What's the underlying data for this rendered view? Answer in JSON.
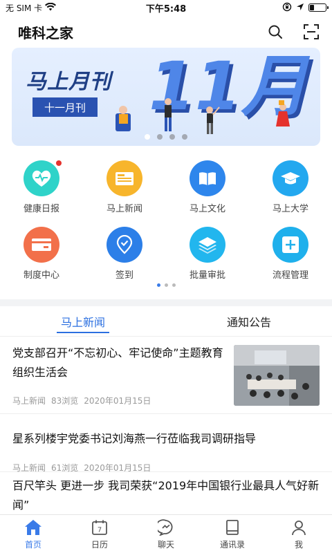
{
  "status_bar": {
    "carrier": "无 SIM 卡",
    "time": "下午5:48",
    "battery_level": 0.3
  },
  "header": {
    "title": "唯科之家",
    "icons": [
      "search-icon",
      "scan-icon"
    ]
  },
  "banner": {
    "title": "马上月刊",
    "subtitle": "十一月刊",
    "big_text": "11月",
    "slide_count": 4,
    "active_slide": 0
  },
  "grid": {
    "items": [
      {
        "label": "健康日报",
        "icon": "heart-pulse-icon",
        "color": "#2fd3c9",
        "badge": true
      },
      {
        "label": "马上新闻",
        "icon": "newspaper-icon",
        "color": "#f7b52c",
        "badge": false
      },
      {
        "label": "马上文化",
        "icon": "book-icon",
        "color": "#2e86ec",
        "badge": false
      },
      {
        "label": "马上大学",
        "icon": "graduation-cap-icon",
        "color": "#23a8ef",
        "badge": false
      },
      {
        "label": "制度中心",
        "icon": "card-icon",
        "color": "#f2704a",
        "badge": false
      },
      {
        "label": "签到",
        "icon": "location-check-icon",
        "color": "#2c7fe8",
        "badge": false
      },
      {
        "label": "批量审批",
        "icon": "layers-icon",
        "color": "#22b6ee",
        "badge": false
      },
      {
        "label": "流程管理",
        "icon": "plus-icon",
        "color": "#1fb0ec",
        "badge": false
      }
    ],
    "page_count": 3,
    "active_page": 0
  },
  "tabs": [
    {
      "label": "马上新闻",
      "active": true
    },
    {
      "label": "通知公告",
      "active": false
    }
  ],
  "news": [
    {
      "title": "党支部召开“不忘初心、牢记使命”主题教育组织生活会",
      "source": "马上新闻",
      "views": "83浏览",
      "date": "2020年01月15日",
      "has_image": true
    },
    {
      "title": "星系列楼宇党委书记刘海燕一行莅临我司调研指导",
      "source": "马上新闻",
      "views": "61浏览",
      "date": "2020年01月15日",
      "has_image": false
    },
    {
      "title": "百尺竿头 更进一步 我司荣获“2019年中国银行业最具人气好新闻”",
      "source": "",
      "views": "",
      "date": "",
      "has_image": false
    }
  ],
  "bottom_nav": [
    {
      "label": "首页",
      "icon": "home-icon",
      "active": true
    },
    {
      "label": "日历",
      "icon": "calendar-icon",
      "active": false,
      "icon_text": "7"
    },
    {
      "label": "聊天",
      "icon": "chat-icon",
      "active": false
    },
    {
      "label": "通讯录",
      "icon": "contacts-book-icon",
      "active": false
    },
    {
      "label": "我",
      "icon": "user-icon",
      "active": false
    }
  ],
  "colors": {
    "accent": "#2b6fe0",
    "nav_active": "#3a7be8",
    "badge": "#e5322d"
  }
}
